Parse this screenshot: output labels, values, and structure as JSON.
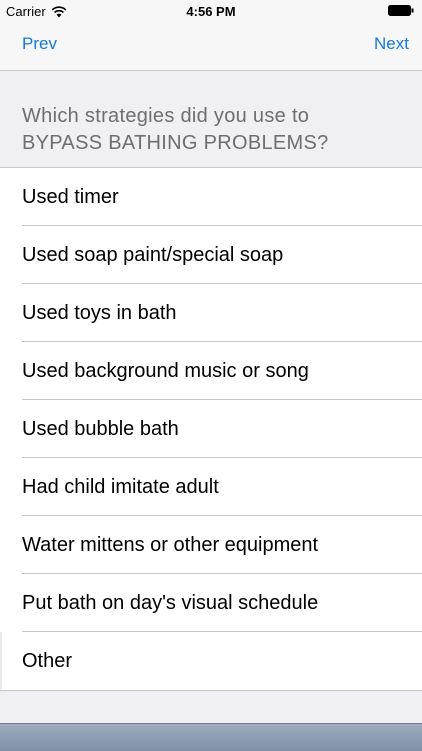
{
  "status_bar": {
    "carrier": "Carrier",
    "time": "4:56 PM"
  },
  "nav": {
    "prev_label": "Prev",
    "next_label": "Next",
    "accent_color": "#1479d8"
  },
  "question": {
    "line1": "Which strategies did you use to",
    "line2": "BYPASS BATHING PROBLEMS?"
  },
  "options": [
    {
      "label": "Used timer"
    },
    {
      "label": "Used soap paint/special soap"
    },
    {
      "label": "Used toys in bath"
    },
    {
      "label": "Used background music or song"
    },
    {
      "label": "Used bubble bath"
    },
    {
      "label": "Had child imitate adult"
    },
    {
      "label": "Water mittens or other equipment"
    },
    {
      "label": "Put bath on day's visual schedule"
    },
    {
      "label": "Other"
    }
  ],
  "icons": {
    "wifi": "wifi-icon",
    "battery": "battery-icon"
  }
}
